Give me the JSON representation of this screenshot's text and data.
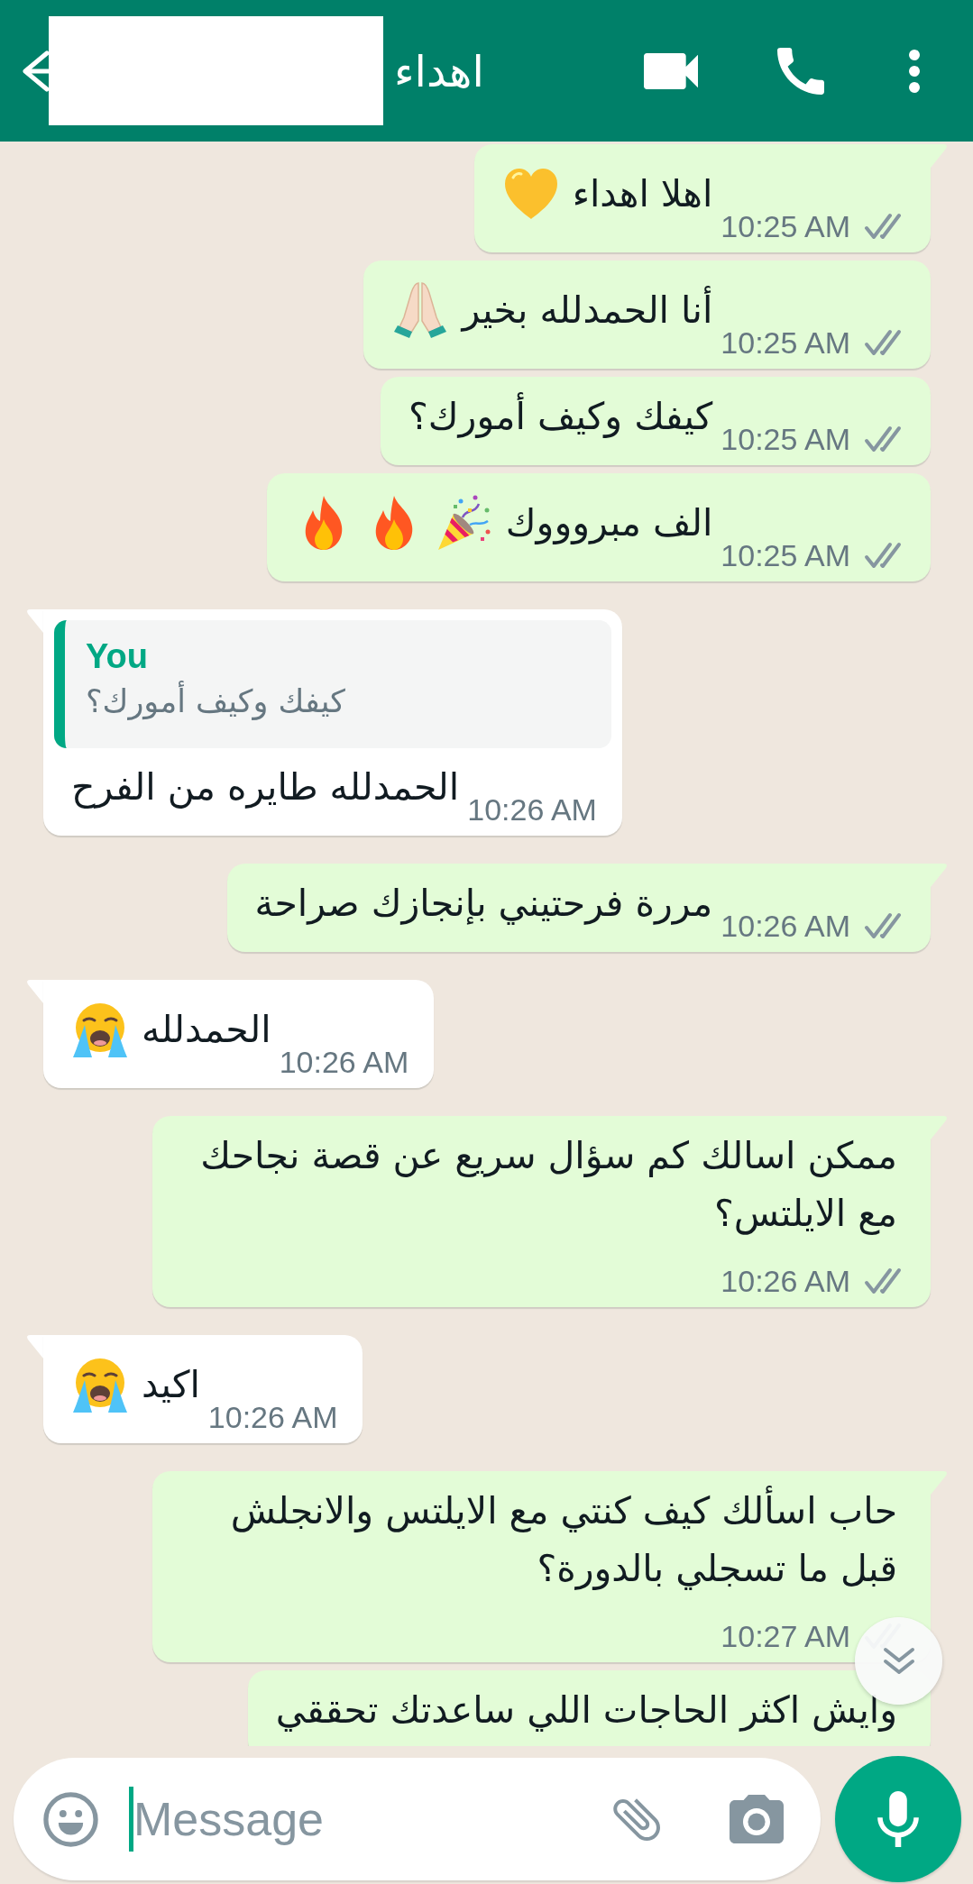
{
  "header": {
    "title": "اهداء"
  },
  "messages": [
    {
      "kind": "outgoing",
      "tail": true,
      "text": "اهلا اهداء",
      "emojis": [
        {
          "kind": "yellow_heart"
        }
      ],
      "time": "10:25 AM",
      "delivered": true,
      "read": false
    },
    {
      "kind": "outgoing",
      "tail": false,
      "text": "أنا الحمدلله بخير",
      "emojis": [
        {
          "kind": "folded_hands"
        }
      ],
      "time": "10:25 AM",
      "delivered": true,
      "read": false
    },
    {
      "kind": "outgoing",
      "tail": false,
      "text": "كيفك وكيف أمورك؟",
      "time": "10:25 AM",
      "delivered": true,
      "read": false
    },
    {
      "kind": "outgoing",
      "tail": false,
      "text": "الف مبروووك",
      "emojis": [
        {
          "kind": "party_popper"
        },
        {
          "kind": "fire"
        },
        {
          "kind": "fire"
        }
      ],
      "time": "10:25 AM",
      "delivered": true,
      "read": false
    },
    {
      "kind": "incoming",
      "tail": true,
      "reply": {
        "author": "You",
        "text": "كيفك وكيف أمورك؟"
      },
      "text": "الحمدلله طايره من الفرح",
      "time": "10:26 AM"
    },
    {
      "kind": "outgoing",
      "tail": true,
      "text": "مررة فرحتيني بإنجازك صراحة",
      "time": "10:26 AM",
      "delivered": true,
      "read": false
    },
    {
      "kind": "incoming",
      "tail": true,
      "text": "الحمدلله",
      "emojis": [
        {
          "kind": "crying_face"
        }
      ],
      "time": "10:26 AM"
    },
    {
      "kind": "outgoing",
      "tail": true,
      "text": "ممكن اسالك كم سؤال سريع عن قصة نجاحك مع الايلتس؟",
      "time": "10:26 AM",
      "delivered": true,
      "read": false
    },
    {
      "kind": "incoming",
      "tail": true,
      "text": "اكيد",
      "emojis": [
        {
          "kind": "crying_face"
        }
      ],
      "time": "10:26 AM"
    },
    {
      "kind": "outgoing",
      "tail": true,
      "text": "حاب اسألك كيف كنتي مع الايلتس والانجلش قبل ما تسجلي بالدورة؟",
      "time": "10:27 AM",
      "delivered": true,
      "read": false
    },
    {
      "kind": "outgoing",
      "tail": false,
      "text": "وايش اكثر الحاجات اللي ساعدتك تحققي"
    }
  ],
  "composer": {
    "placeholder": "Message"
  }
}
